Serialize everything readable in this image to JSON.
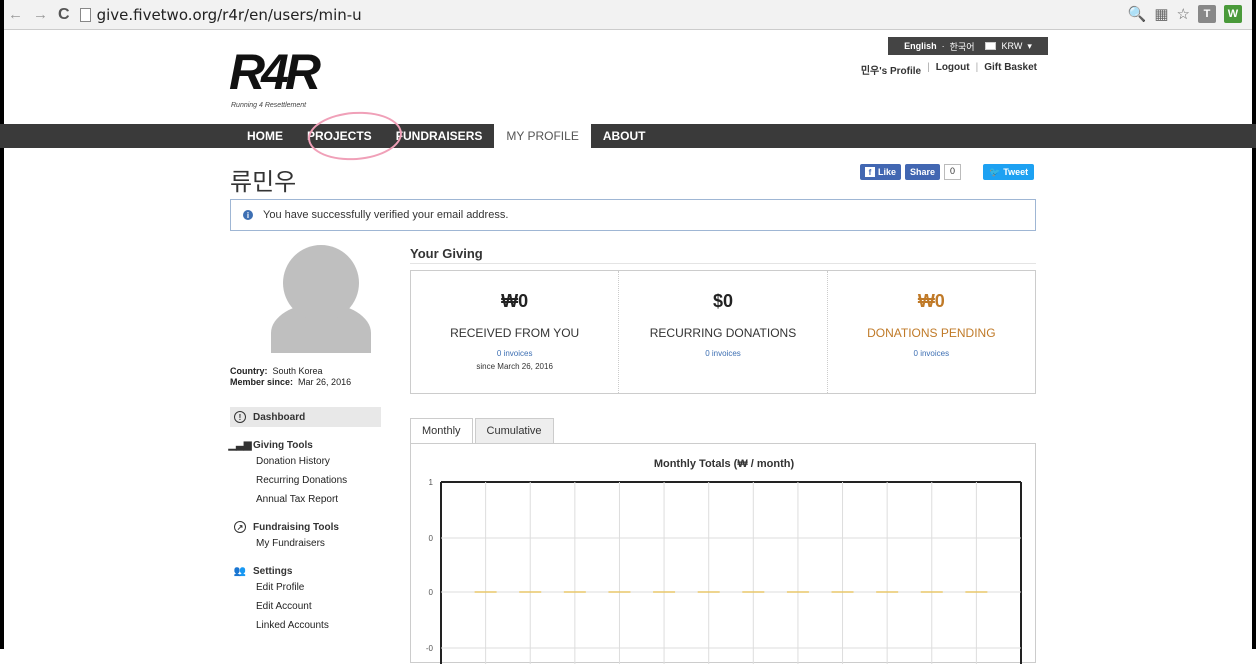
{
  "browser": {
    "url": "give.fivetwo.org/r4r/en/users/min-u",
    "ext_t": "T",
    "ext_w": "W"
  },
  "header": {
    "lang_english": "English",
    "lang_korean": "한국어",
    "currency": "KRW",
    "profile_link": "민우's Profile",
    "logout": "Logout",
    "gift_basket": "Gift Basket",
    "logo_text": "R4R",
    "logo_tagline": "Running 4 Resettlement"
  },
  "nav": {
    "items": [
      "HOME",
      "PROJECTS",
      "FUNDRAISERS",
      "MY PROFILE",
      "ABOUT"
    ]
  },
  "page": {
    "title": "류민우",
    "alert": "You have successfully verified your email address."
  },
  "social": {
    "like": "Like",
    "share": "Share",
    "share_count": "0",
    "tweet": "Tweet"
  },
  "profile": {
    "country_label": "Country:",
    "country": "South Korea",
    "member_label": "Member since:",
    "member_since": "Mar 26, 2016"
  },
  "sidebar": {
    "dashboard": "Dashboard",
    "groups": [
      {
        "title": "Giving Tools",
        "items": [
          "Donation History",
          "Recurring Donations",
          "Annual Tax Report"
        ]
      },
      {
        "title": "Fundraising Tools",
        "items": [
          "My Fundraisers"
        ]
      },
      {
        "title": "Settings",
        "items": [
          "Edit Profile",
          "Edit Account",
          "Linked Accounts"
        ]
      }
    ]
  },
  "giving": {
    "title": "Your Giving",
    "received_amount": "₩0",
    "received_label": "RECEIVED FROM YOU",
    "received_invoices": "0 invoices",
    "received_since": "since March 26, 2016",
    "recurring_amount": "$0",
    "recurring_label": "RECURRING DONATIONS",
    "recurring_invoices": "0 invoices",
    "pending_amount": "₩0",
    "pending_label": "DONATIONS PENDING",
    "pending_invoices": "0 invoices"
  },
  "tabs": [
    "Monthly",
    "Cumulative"
  ],
  "colors": {
    "navbar": "#3a3a3a",
    "pending": "#c07a28",
    "link": "#3d6fb3",
    "series": "#e8c76a"
  },
  "chart_data": {
    "type": "line",
    "title": "Monthly Totals (₩ / month)",
    "y_ticks": [
      "1",
      "0",
      "0",
      "-0"
    ],
    "series": [
      {
        "values": [
          0,
          0,
          0,
          0,
          0,
          0,
          0,
          0,
          0,
          0,
          0,
          0
        ]
      }
    ],
    "grid": true
  }
}
